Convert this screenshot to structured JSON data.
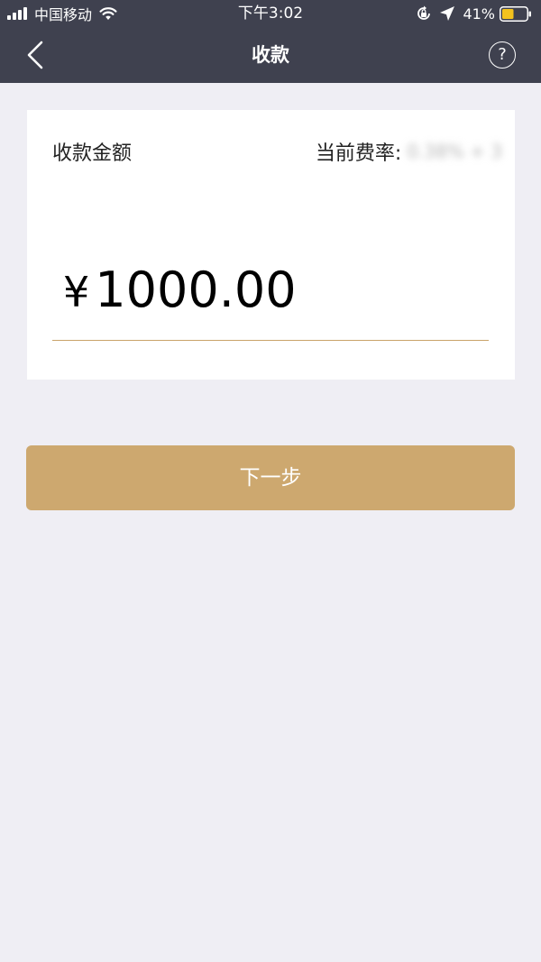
{
  "status_bar": {
    "carrier": "中国移动",
    "time": "下午3:02",
    "battery_percent": "41%",
    "icons": [
      "signal-icon",
      "wifi-icon",
      "lock-rotation-icon",
      "location-arrow-icon",
      "battery-icon"
    ]
  },
  "nav": {
    "title": "收款",
    "back_icon": "chevron-left-icon",
    "help_label": "?"
  },
  "amount_card": {
    "amount_label": "收款金额",
    "rate_label": "当前费率:",
    "rate_value": "0.38% + 3",
    "currency_symbol": "¥",
    "amount": "1000.00"
  },
  "actions": {
    "next_label": "下一步"
  },
  "colors": {
    "header_bg": "#3f414f",
    "page_bg": "#efeef4",
    "accent": "#cda86f",
    "underline": "#c9a36a"
  }
}
